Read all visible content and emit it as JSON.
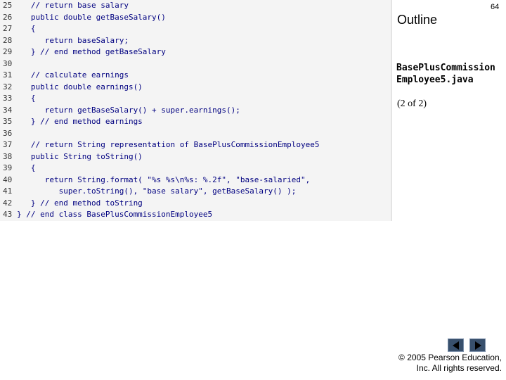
{
  "slide": {
    "number": "64",
    "outline_label": "Outline",
    "file_name_line1": "BasePlusCommission",
    "file_name_line2": "Employee5.java",
    "part_label": "(2 of 2)",
    "copyright_line1": "© 2005 Pearson Education,",
    "copyright_line2": "Inc.  All rights reserved."
  },
  "code": {
    "lines": [
      {
        "num": "25",
        "text": "   // return base salary"
      },
      {
        "num": "26",
        "text": "   public double getBaseSalary()"
      },
      {
        "num": "27",
        "text": "   {"
      },
      {
        "num": "28",
        "text": "      return baseSalary;"
      },
      {
        "num": "29",
        "text": "   } // end method getBaseSalary"
      },
      {
        "num": "30",
        "text": ""
      },
      {
        "num": "31",
        "text": "   // calculate earnings"
      },
      {
        "num": "32",
        "text": "   public double earnings()"
      },
      {
        "num": "33",
        "text": "   {"
      },
      {
        "num": "34",
        "text": "      return getBaseSalary() + super.earnings();"
      },
      {
        "num": "35",
        "text": "   } // end method earnings"
      },
      {
        "num": "36",
        "text": ""
      },
      {
        "num": "37",
        "text": "   // return String representation of BasePlusCommissionEmployee5"
      },
      {
        "num": "38",
        "text": "   public String toString()"
      },
      {
        "num": "39",
        "text": "   {"
      },
      {
        "num": "40",
        "text": "      return String.format( \"%s %s\\n%s: %.2f\", \"base-salaried\","
      },
      {
        "num": "41",
        "text": "         super.toString(), \"base salary\", getBaseSalary() );"
      },
      {
        "num": "42",
        "text": "   } // end method toString"
      },
      {
        "num": "43",
        "text": "} // end class BasePlusCommissionEmployee5"
      }
    ]
  },
  "icons": {
    "prev": "triangle-left-icon",
    "next": "triangle-right-icon"
  },
  "colors": {
    "code_text": "#000080",
    "code_background": "#f4f4f4",
    "nav_button": "#38506d"
  }
}
